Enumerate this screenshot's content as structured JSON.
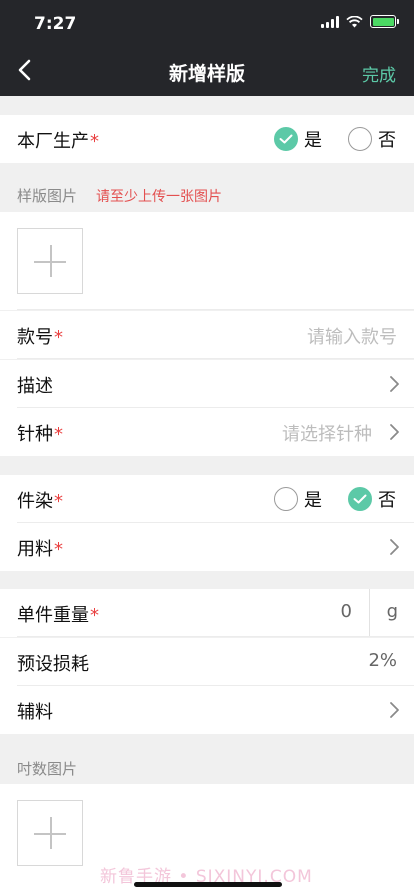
{
  "status": {
    "time": "7:27"
  },
  "nav": {
    "title": "新增样版",
    "done": "完成"
  },
  "own_factory": {
    "label": "本厂生产",
    "required": "*",
    "yes": "是",
    "no": "否",
    "selected": "yes"
  },
  "sample_images": {
    "title": "样版图片",
    "hint": "请至少上传一张图片"
  },
  "style_no": {
    "label": "款号",
    "required": "*",
    "placeholder": "请输入款号"
  },
  "description": {
    "label": "描述"
  },
  "needle": {
    "label": "针种",
    "required": "*",
    "placeholder": "请选择针种"
  },
  "piece_dye": {
    "label": "件染",
    "required": "*",
    "yes": "是",
    "no": "否",
    "selected": "no"
  },
  "material": {
    "label": "用料",
    "required": "*"
  },
  "unit_weight": {
    "label": "单件重量",
    "required": "*",
    "value": "0",
    "unit": "g"
  },
  "loss": {
    "label": "预设损耗",
    "value": "2%"
  },
  "accessories": {
    "label": "辅料"
  },
  "measure_images": {
    "title": "吋数图片"
  },
  "watermark": "新鲁手游 • SIXINYI.COM",
  "colors": {
    "accent": "#5cc9a7",
    "header_bg": "#25262a",
    "required": "#e94040"
  }
}
